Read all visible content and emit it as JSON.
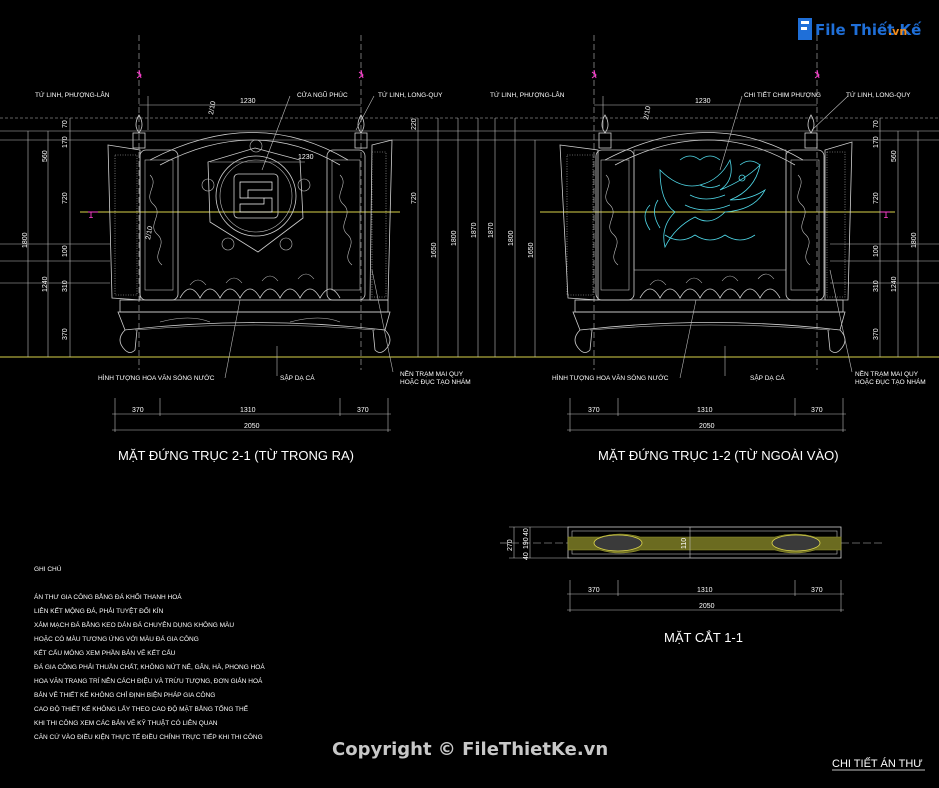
{
  "logo": {
    "text": "File Thiết Kế",
    "domain": ".vn"
  },
  "elevation_left": {
    "title": "MẶT ĐỨNG TRỤC 2-1 (TỪ TRONG RA)",
    "labels": {
      "top_left": "TỨ LINH, PHƯỢNG-LÂN",
      "top_center": "CỬA NGŨ PHÚC",
      "top_right": "TỨ LINH, LONG-QUY",
      "bottom_left": "HÌNH TƯỢNG HOA VĂN SÓNG NƯỚC",
      "bottom_center": "SẬP DẠ CÁ",
      "bottom_right_1": "NỀN TRẠM MAI QUY",
      "bottom_right_2": "HOẶC ĐỤC TẠO NHÁM"
    },
    "dims_top": [
      "1230",
      "1230"
    ],
    "dims_left": [
      "560",
      "170",
      "70",
      "720",
      "100",
      "310",
      "370",
      "1240",
      "1800"
    ],
    "dims_right": [
      "220",
      "720",
      "1650",
      "1800",
      "1870"
    ],
    "inner_dims": [
      "2/10",
      "2/10"
    ],
    "dims_bottom": [
      "370",
      "1310",
      "370",
      "2050"
    ]
  },
  "elevation_right": {
    "title": "MẶT ĐỨNG TRỤC 1-2 (TỪ NGOÀI VÀO)",
    "labels": {
      "top_left": "TỨ LINH, PHƯỢNG-LÂN",
      "top_center": "CHI TIẾT CHIM PHƯỢNG",
      "top_right": "TỨ LINH, LONG-QUY",
      "bottom_left": "HÌNH TƯỢNG HOA VĂN SÓNG NƯỚC",
      "bottom_center": "SẬP DẠ CÁ",
      "bottom_right_1": "NỀN TRẠM MAI QUY",
      "bottom_right_2": "HOẶC ĐỤC TẠO NHÁM"
    },
    "dims_top": [
      "1230",
      "2/10"
    ],
    "dims_left": [
      "1870",
      "1800",
      "1650"
    ],
    "dims_right": [
      "170",
      "560",
      "70",
      "720",
      "100",
      "310",
      "370",
      "1240",
      "1800"
    ],
    "dims_bottom": [
      "370",
      "1310",
      "370",
      "2050"
    ]
  },
  "section": {
    "title": "MẶT CẮT 1-1",
    "dims_left": [
      "270",
      "40",
      "190",
      "40"
    ],
    "inner_dim": "110",
    "dims_bottom": [
      "370",
      "1310",
      "370",
      "2050"
    ]
  },
  "notes": {
    "heading": "GHI CHÚ",
    "lines": [
      "ÁN THƯ GIA CÔNG BẰNG ĐÁ KHỐI THANH HOÁ",
      "LIÊN KẾT MỘNG ĐÁ, PHẢI TUYỆT ĐỐI KÍN",
      "XẢM MẠCH ĐÁ BẰNG KEO DÁN ĐÁ CHUYÊN DỤNG KHÔNG MÀU",
      "HOẶC CÓ MÀU TƯƠNG ỨNG VỚI MÀU ĐÁ GIA CÔNG",
      "KẾT CẤU MÓNG XEM PHẦN BẢN VẼ KẾT CẤU",
      "ĐÁ GIA CÔNG PHẢI THUẦN CHẤT, KHÔNG NỨT NẺ, GÂN, HÀ, PHONG HOÁ",
      "HOA VĂN TRANG TRÍ NÊN CÁCH ĐIỆU VÀ TRỪU TƯỢNG, ĐƠN GIẢN HOÁ",
      "BẢN VẼ THIẾT KẾ KHÔNG CHỈ ĐỊNH BIỆN PHÁP GIA CÔNG",
      "CAO ĐỘ THIẾT KẾ KHÔNG LẤY THEO CAO ĐỘ MẶT BẰNG TỔNG THỂ",
      "KHI THI CÔNG XEM CÁC BẢN VẼ KỸ THUẬT CÓ LIÊN QUAN",
      "CĂN CỨ VÀO ĐIỀU KIỆN THỰC TẾ ĐIỀU CHỈNH TRỰC TIẾP KHI THI CÔNG"
    ]
  },
  "watermark": "Copyright © FileThietKe.vn",
  "sheet_title": "CHI TIẾT ÁN THƯ",
  "section_marks": [
    "1",
    "1"
  ],
  "colors": {
    "background": "#000000",
    "guide_yellow": "#d9d24a",
    "magenta": "#ff3fd0",
    "logo_blue": "#1f6fd8",
    "logo_orange": "#f08c1e",
    "phoenix": "#4fd8e8"
  }
}
